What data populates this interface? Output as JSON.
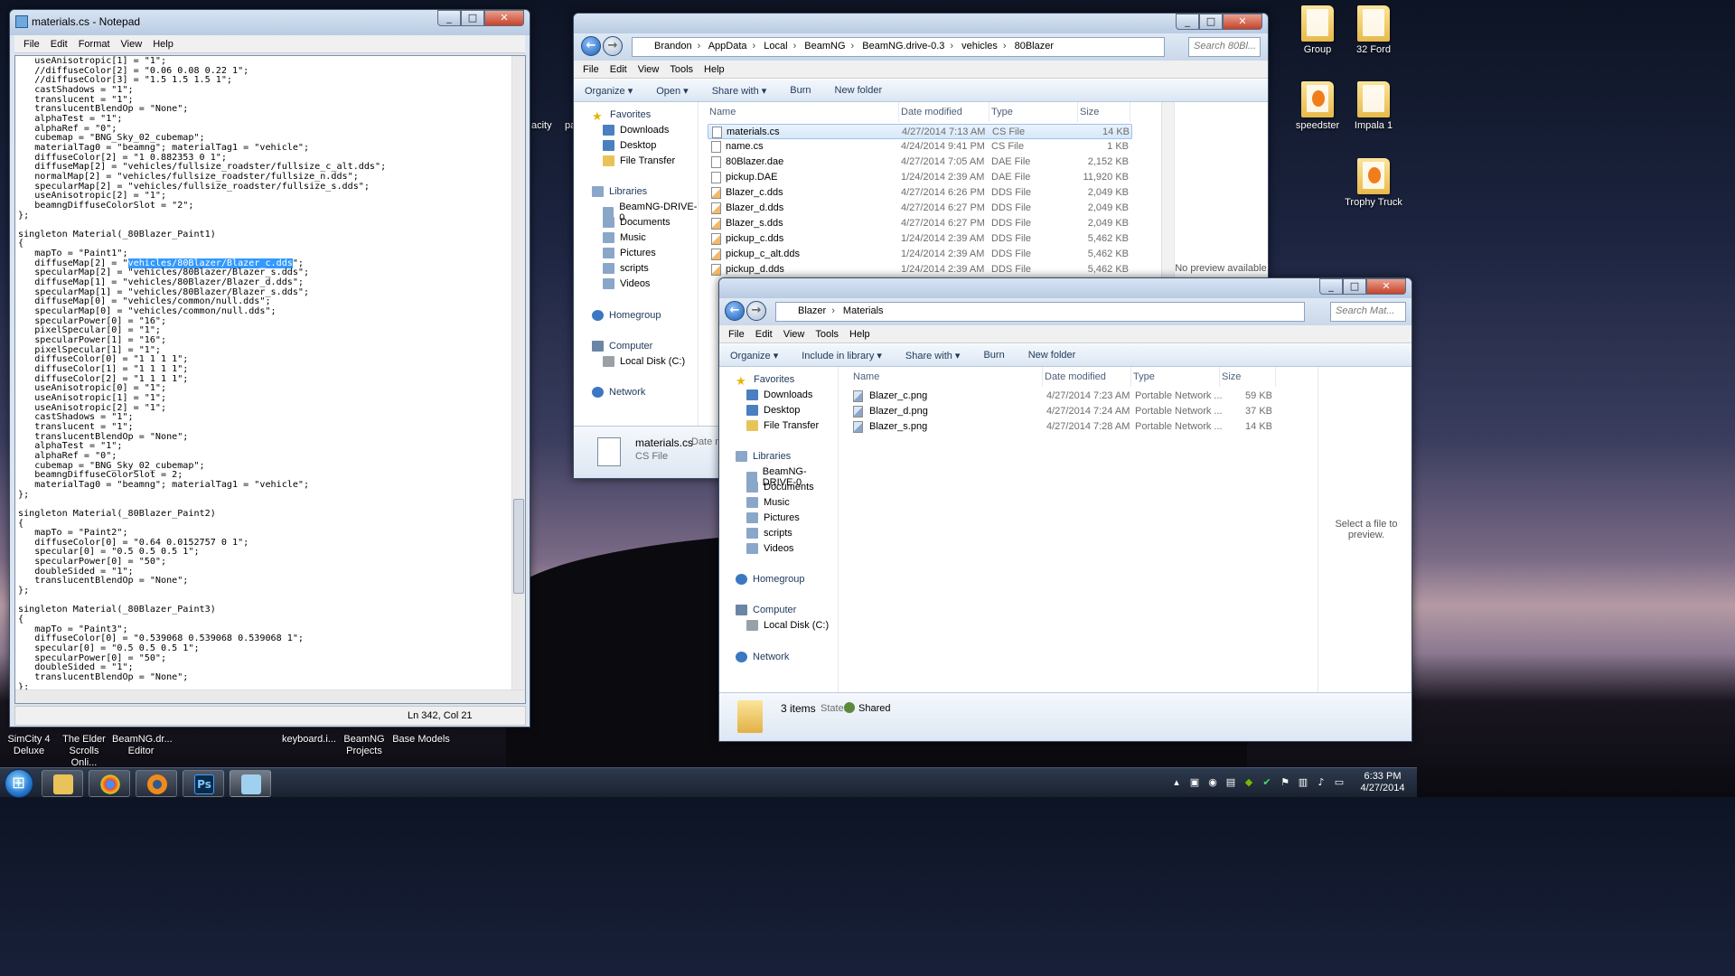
{
  "desktop": {
    "icons": [
      {
        "label": "Group"
      },
      {
        "label": "32 Ford"
      },
      {
        "label": "speedster"
      },
      {
        "label": "Impala 1"
      },
      {
        "label": "Trophy Truck"
      }
    ],
    "bottom_labels": [
      {
        "line1": "SimCity 4",
        "line2": "Deluxe"
      },
      {
        "line1": "The Elder",
        "line2": "Scrolls Onli..."
      },
      {
        "line1": "BeamNG.dr...",
        "line2": "Editor"
      },
      {
        "line1": "keyboard.i...",
        "line2": ""
      },
      {
        "line1": "BeamNG",
        "line2": "Projects"
      },
      {
        "line1": "Base Models",
        "line2": ""
      }
    ],
    "partial_labels": {
      "left": "acity",
      "right": "pa"
    }
  },
  "notepad": {
    "title": "materials.cs - Notepad",
    "menu": [
      "File",
      "Edit",
      "Format",
      "View",
      "Help"
    ],
    "lines_before": [
      "   useAnisotropic[1] = \"1\";",
      "   //diffuseColor[2] = \"0.06 0.08 0.22 1\";",
      "   //diffuseColor[3] = \"1.5 1.5 1.5 1\";",
      "   castShadows = \"1\";",
      "   translucent = \"1\";",
      "   translucentBlendOp = \"None\";",
      "   alphaTest = \"1\";",
      "   alphaRef = \"0\";",
      "   cubemap = \"BNG_Sky_02_cubemap\";",
      "   materialTag0 = \"beamng\"; materialTag1 = \"vehicle\";",
      "   diffuseColor[2] = \"1 0.882353 0 1\";",
      "   diffuseMap[2] = \"vehicles/fullsize_roadster/fullsize_c_alt.dds\";",
      "   normalMap[2] = \"vehicles/fullsize_roadster/fullsize_n.dds\";",
      "   specularMap[2] = \"vehicles/fullsize_roadster/fullsize_s.dds\";",
      "   useAnisotropic[2] = \"1\";",
      "   beamngDiffuseColorSlot = \"2\";",
      "};",
      "",
      "singleton Material(_80Blazer_Paint1)",
      "{",
      "   mapTo = \"Paint1\";"
    ],
    "hl_prefix": "   diffuseMap[2] = \"",
    "hl_text": "vehicles/80Blazer/Blazer_c.dds",
    "hl_suffix": "\";",
    "lines_after": [
      "   specularMap[2] = \"vehicles/80Blazer/Blazer_s.dds\";",
      "   diffuseMap[1] = \"vehicles/80Blazer/Blazer_d.dds\";",
      "   specularMap[1] = \"vehicles/80Blazer/Blazer_s.dds\";",
      "   diffuseMap[0] = \"vehicles/common/null.dds\";",
      "   specularMap[0] = \"vehicles/common/null.dds\";",
      "   specularPower[0] = \"16\";",
      "   pixelSpecular[0] = \"1\";",
      "   specularPower[1] = \"16\";",
      "   pixelSpecular[1] = \"1\";",
      "   diffuseColor[0] = \"1 1 1 1\";",
      "   diffuseColor[1] = \"1 1 1 1\";",
      "   diffuseColor[2] = \"1 1 1 1\";",
      "   useAnisotropic[0] = \"1\";",
      "   useAnisotropic[1] = \"1\";",
      "   useAnisotropic[2] = \"1\";",
      "   castShadows = \"1\";",
      "   translucent = \"1\";",
      "   translucentBlendOp = \"None\";",
      "   alphaTest = \"1\";",
      "   alphaRef = \"0\";",
      "   cubemap = \"BNG_Sky_02_cubemap\";",
      "   beamngDiffuseColorSlot = 2;",
      "   materialTag0 = \"beamng\"; materialTag1 = \"vehicle\";",
      "};",
      "",
      "singleton Material(_80Blazer_Paint2)",
      "{",
      "   mapTo = \"Paint2\";",
      "   diffuseColor[0] = \"0.64 0.0152757 0 1\";",
      "   specular[0] = \"0.5 0.5 0.5 1\";",
      "   specularPower[0] = \"50\";",
      "   doubleSided = \"1\";",
      "   translucentBlendOp = \"None\";",
      "};",
      "",
      "singleton Material(_80Blazer_Paint3)",
      "{",
      "   mapTo = \"Paint3\";",
      "   diffuseColor[0] = \"0.539068 0.539068 0.539068 1\";",
      "   specular[0] = \"0.5 0.5 0.5 1\";",
      "   specularPower[0] = \"50\";",
      "   doubleSided = \"1\";",
      "   translucentBlendOp = \"None\";",
      "};"
    ],
    "status": "Ln 342, Col 21"
  },
  "explorer1": {
    "path": [
      "Brandon",
      "AppData",
      "Local",
      "BeamNG",
      "BeamNG.drive-0.3",
      "vehicles",
      "80Blazer"
    ],
    "search_placeholder": "Search 80Bl...",
    "menu": [
      "File",
      "Edit",
      "View",
      "Tools",
      "Help"
    ],
    "commands": [
      "Organize ▾",
      "Open ▾",
      "Share with ▾",
      "Burn",
      "New folder"
    ],
    "nav": {
      "favorites": "Favorites",
      "fav_items": [
        "Downloads",
        "Desktop",
        "File Transfer"
      ],
      "libraries": "Libraries",
      "lib_items": [
        "BeamNG-DRIVE-0",
        "Documents",
        "Music",
        "Pictures",
        "scripts",
        "Videos"
      ],
      "homegroup": "Homegroup",
      "computer": "Computer",
      "disk": "Local Disk (C:)",
      "network": "Network"
    },
    "columns": [
      "Name",
      "Date modified",
      "Type",
      "Size"
    ],
    "files": [
      {
        "name": "materials.cs",
        "date": "4/27/2014 7:13 AM",
        "type": "CS File",
        "size": "14 KB",
        "kind": "cs"
      },
      {
        "name": "name.cs",
        "date": "4/24/2014 9:41 PM",
        "type": "CS File",
        "size": "1 KB",
        "kind": "cs"
      },
      {
        "name": "80Blazer.dae",
        "date": "4/27/2014 7:05 AM",
        "type": "DAE File",
        "size": "2,152 KB",
        "kind": "dae"
      },
      {
        "name": "pickup.DAE",
        "date": "1/24/2014 2:39 AM",
        "type": "DAE File",
        "size": "11,920 KB",
        "kind": "dae"
      },
      {
        "name": "Blazer_c.dds",
        "date": "4/27/2014 6:26 PM",
        "type": "DDS File",
        "size": "2,049 KB",
        "kind": "dds"
      },
      {
        "name": "Blazer_d.dds",
        "date": "4/27/2014 6:27 PM",
        "type": "DDS File",
        "size": "2,049 KB",
        "kind": "dds"
      },
      {
        "name": "Blazer_s.dds",
        "date": "4/27/2014 6:27 PM",
        "type": "DDS File",
        "size": "2,049 KB",
        "kind": "dds"
      },
      {
        "name": "pickup_c.dds",
        "date": "1/24/2014 2:39 AM",
        "type": "DDS File",
        "size": "5,462 KB",
        "kind": "dds"
      },
      {
        "name": "pickup_c_alt.dds",
        "date": "1/24/2014 2:39 AM",
        "type": "DDS File",
        "size": "5,462 KB",
        "kind": "dds"
      },
      {
        "name": "pickup_d.dds",
        "date": "1/24/2014 2:39 AM",
        "type": "DDS File",
        "size": "5,462 KB",
        "kind": "dds"
      }
    ],
    "preview": "No preview available.",
    "details_name": "materials.cs",
    "details_type": "CS File",
    "details_date_label": "Date m"
  },
  "explorer2": {
    "path": [
      "Blazer",
      "Materials"
    ],
    "search_placeholder": "Search Mat...",
    "menu": [
      "File",
      "Edit",
      "View",
      "Tools",
      "Help"
    ],
    "commands": [
      "Organize ▾",
      "Include in library ▾",
      "Share with ▾",
      "Burn",
      "New folder"
    ],
    "nav": {
      "favorites": "Favorites",
      "fav_items": [
        "Downloads",
        "Desktop",
        "File Transfer"
      ],
      "libraries": "Libraries",
      "lib_items": [
        "BeamNG-DRIVE-0",
        "Documents",
        "Music",
        "Pictures",
        "scripts",
        "Videos"
      ],
      "homegroup": "Homegroup",
      "computer": "Computer",
      "disk": "Local Disk (C:)",
      "network": "Network"
    },
    "columns": [
      "Name",
      "Date modified",
      "Type",
      "Size"
    ],
    "files": [
      {
        "name": "Blazer_c.png",
        "date": "4/27/2014 7:23 AM",
        "type": "Portable Network ...",
        "size": "59 KB"
      },
      {
        "name": "Blazer_d.png",
        "date": "4/27/2014 7:24 AM",
        "type": "Portable Network ...",
        "size": "37 KB"
      },
      {
        "name": "Blazer_s.png",
        "date": "4/27/2014 7:28 AM",
        "type": "Portable Network ...",
        "size": "14 KB"
      }
    ],
    "preview": "Select a file to preview.",
    "items_count": "3 items",
    "state_label": "State:",
    "state_value": "Shared"
  },
  "taskbar": {
    "time": "6:33 PM",
    "date": "4/27/2014"
  }
}
